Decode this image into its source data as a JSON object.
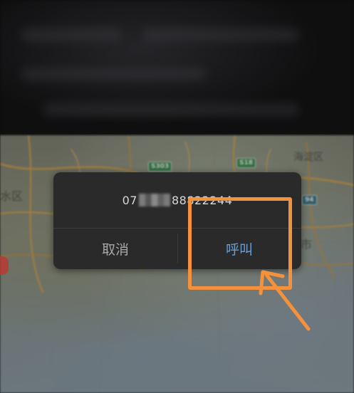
{
  "dialog": {
    "number_prefix": "07",
    "number_suffix": "88822244",
    "cancel_label": "取消",
    "call_label": "呼叫"
  },
  "map": {
    "labels": {
      "district_left": "水区",
      "district_right": "海淀区",
      "city": "市"
    },
    "roads": {
      "s303": "S303",
      "s18": "S18",
      "r94": "94"
    }
  },
  "colors": {
    "dialog_bg": "#2a2a2b",
    "call_button": "#6a9fd6",
    "cancel_button": "#a9a9a9",
    "annotation": "#f4913c"
  },
  "icons": {
    "map_pin": "map-pin-icon",
    "annotation_arrow": "arrow-icon"
  }
}
